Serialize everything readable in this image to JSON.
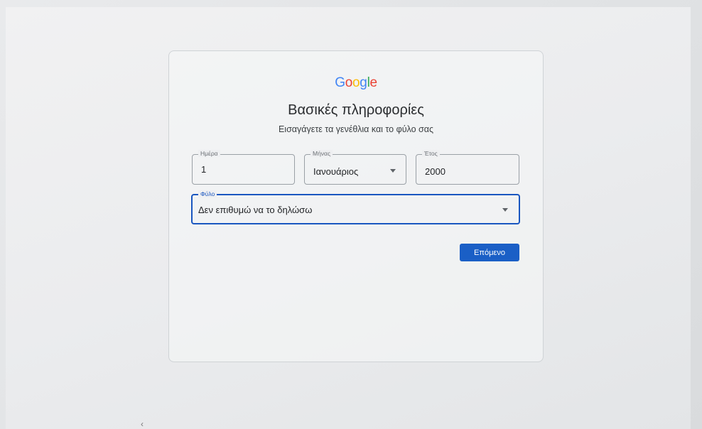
{
  "header": {
    "logo_letters": [
      {
        "char": "G",
        "color": "#4285F4"
      },
      {
        "char": "o",
        "color": "#EA4335"
      },
      {
        "char": "o",
        "color": "#FBBC05"
      },
      {
        "char": "g",
        "color": "#4285F4"
      },
      {
        "char": "l",
        "color": "#34A853"
      },
      {
        "char": "e",
        "color": "#EA4335"
      }
    ],
    "title": "Βασικές πληροφορίες",
    "subtitle": "Εισαγάγετε τα γενέθλια και το φύλο σας"
  },
  "form": {
    "day": {
      "label": "Ημέρα",
      "value": "1"
    },
    "month": {
      "label": "Μήνας",
      "value": "Ιανουάριος"
    },
    "year": {
      "label": "Έτος",
      "value": "2000"
    },
    "gender": {
      "label": "Φύλο",
      "value": "Δεν επιθυμώ να το δηλώσω"
    }
  },
  "actions": {
    "next_label": "Επόμενο"
  },
  "colors": {
    "accent": "#1a5fc6",
    "focus": "#1a57c0"
  }
}
